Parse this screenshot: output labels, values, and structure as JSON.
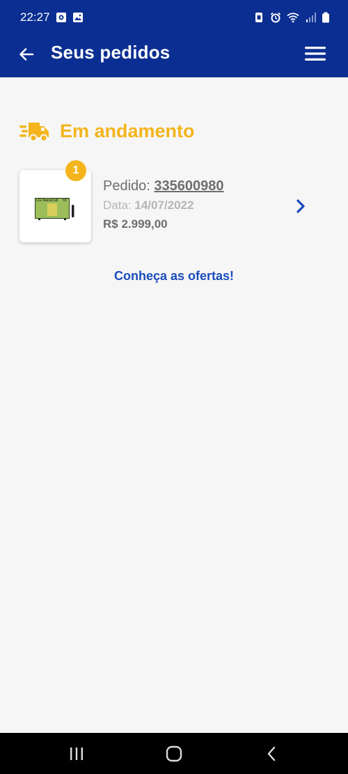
{
  "status_bar": {
    "time": "22:27",
    "icons": [
      "notification-icon",
      "gallery-icon",
      "nfc-icon",
      "alarm-icon",
      "wifi-icon",
      "signal-icon",
      "battery-icon"
    ]
  },
  "header": {
    "title": "Seus pedidos",
    "back_icon": "arrow-left-icon",
    "menu_icon": "hamburger-menu-icon"
  },
  "section": {
    "title": "Em andamento",
    "icon": "delivery-truck-icon"
  },
  "orders": [
    {
      "badge": "1",
      "pedido_label": "Pedido:",
      "pedido_number": "335600980",
      "data_label": "Data:",
      "data_value": "14/07/2022",
      "price": "R$ 2.999,00",
      "product_text": "LG NanoCell",
      "product_size": "55\""
    }
  ],
  "offers_link": "Conheça as ofertas!",
  "nav": {
    "recents_icon": "recents-icon",
    "home_icon": "home-icon",
    "back_icon": "back-icon"
  },
  "colors": {
    "primary": "#0a2e91",
    "accent": "#f4b51c",
    "link": "#1a4bbd"
  }
}
